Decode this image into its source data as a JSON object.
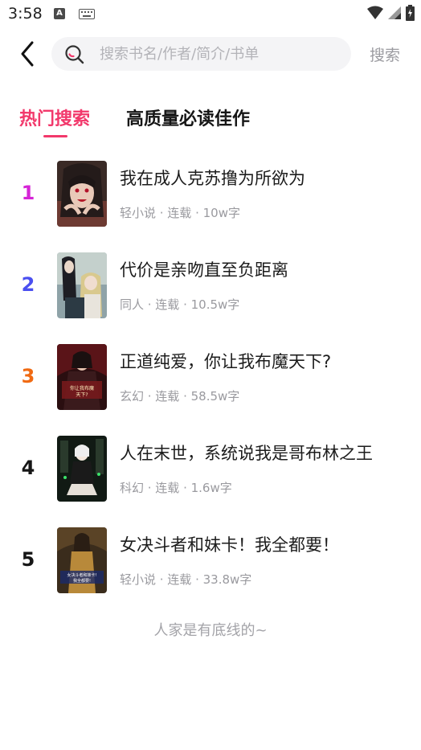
{
  "status_bar": {
    "time": "3:58",
    "a_badge": "A"
  },
  "search": {
    "placeholder": "搜索书名/作者/简介/书单",
    "button_label": "搜索"
  },
  "tabs": [
    {
      "label": "热门搜索",
      "active": true
    },
    {
      "label": "高质量必读佳作",
      "active": false
    }
  ],
  "colors": {
    "accent": "#f2386b",
    "rank1": "#d524d6",
    "rank2": "#4a4ff0",
    "rank3": "#f06a12",
    "rank_default": "#161616"
  },
  "books": [
    {
      "rank": "1",
      "title": "我在成人克苏撸为所欲为",
      "meta": "轻小说 · 连载 · 10w字"
    },
    {
      "rank": "2",
      "title": "代价是亲吻直至负距离",
      "meta": "同人 · 连载 · 10.5w字"
    },
    {
      "rank": "3",
      "title": "正道纯爱，你让我布魔天下?",
      "meta": "玄幻 · 连载 · 58.5w字",
      "cover_text": "你让我布魔天下?"
    },
    {
      "rank": "4",
      "title": "人在末世，系统说我是哥布林之王",
      "meta": "科幻 · 连载 · 1.6w字"
    },
    {
      "rank": "5",
      "title": "女决斗者和妹卡！我全都要！",
      "meta": "轻小说 · 连载 · 33.8w字",
      "cover_text": "女决斗者和妹卡! 我全都要!"
    }
  ],
  "footer": "人家是有底线的~"
}
